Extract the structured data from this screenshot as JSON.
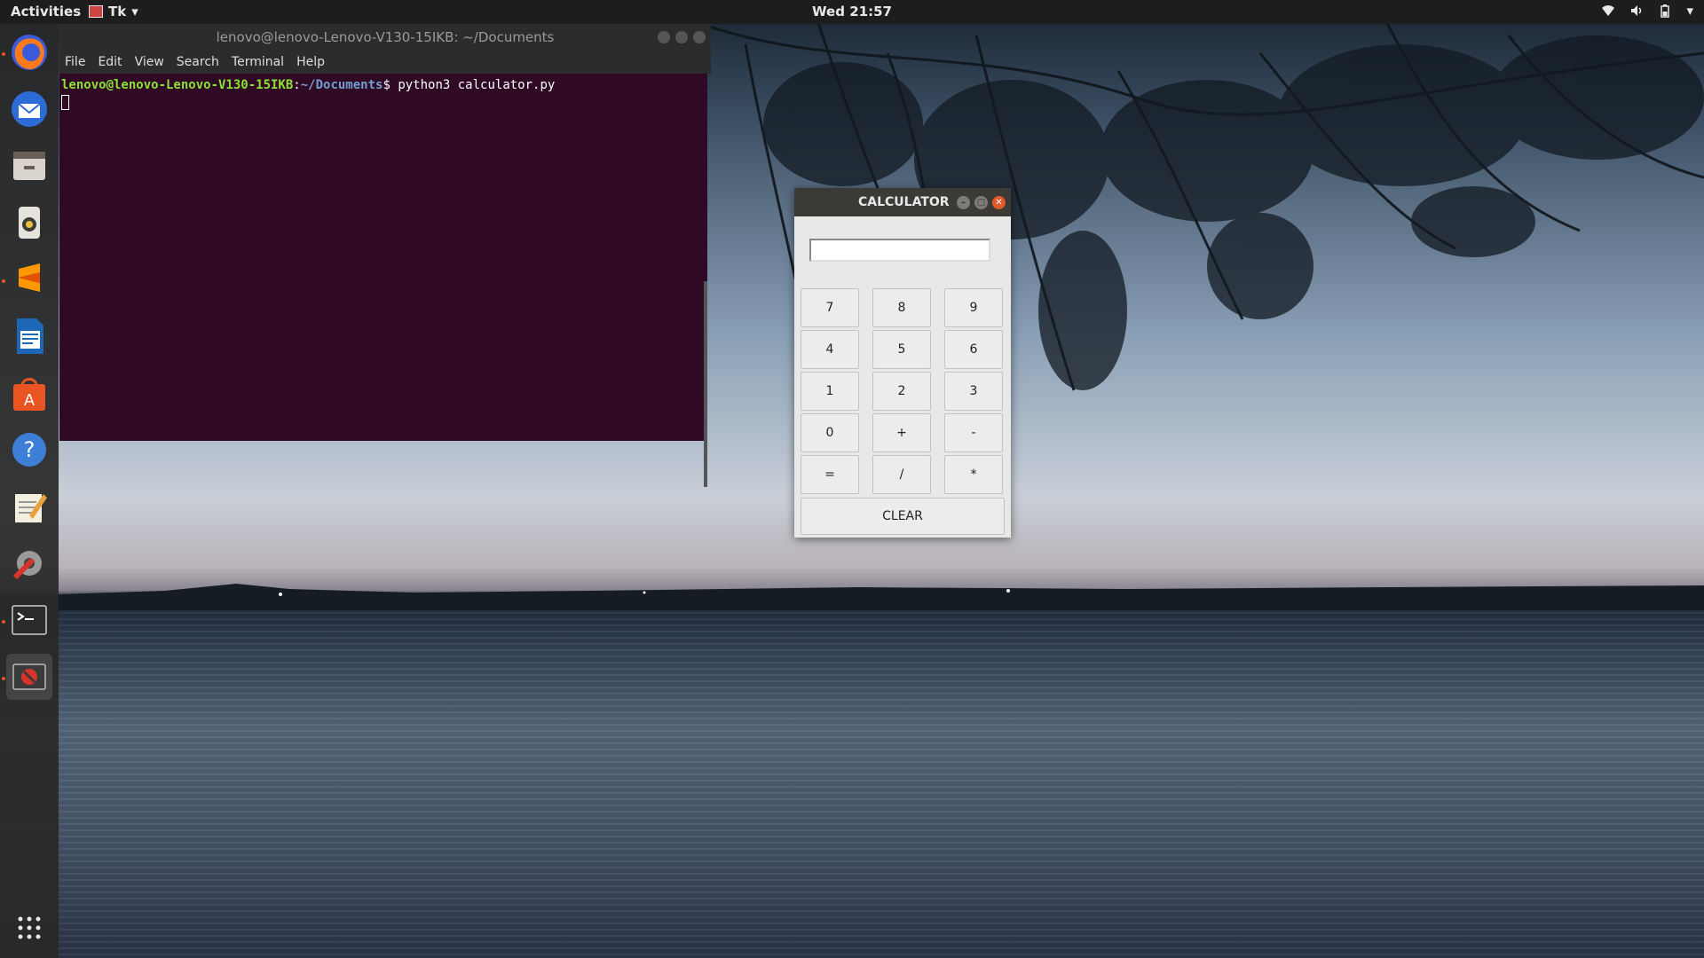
{
  "topbar": {
    "activities": "Activities",
    "app_menu": "Tk",
    "clock": "Wed 21:57",
    "tray_icons": [
      "wifi-icon",
      "volume-icon",
      "battery-icon",
      "chevron-down-icon"
    ]
  },
  "dock": {
    "items": [
      {
        "name": "firefox",
        "running": true
      },
      {
        "name": "thunderbird",
        "running": false
      },
      {
        "name": "files",
        "running": false
      },
      {
        "name": "rhythmbox",
        "running": false
      },
      {
        "name": "sublime-text",
        "running": true
      },
      {
        "name": "libreoffice-writer",
        "running": false
      },
      {
        "name": "ubuntu-software",
        "running": false
      },
      {
        "name": "help",
        "running": false
      },
      {
        "name": "text-editor",
        "running": false
      },
      {
        "name": "settings",
        "running": false
      },
      {
        "name": "terminal",
        "running": true
      },
      {
        "name": "tk-app",
        "running": true
      }
    ]
  },
  "terminal": {
    "title": "lenovo@lenovo-Lenovo-V130-15IKB: ~/Documents",
    "menu": [
      "File",
      "Edit",
      "View",
      "Search",
      "Terminal",
      "Help"
    ],
    "prompt_user": "lenovo@lenovo-Lenovo-V130-15IKB",
    "prompt_sep": ":",
    "prompt_path": "~/Documents",
    "prompt_suffix": "$ ",
    "command": "python3 calculator.py"
  },
  "calculator": {
    "title": "CALCULATOR",
    "display_value": "",
    "buttons": [
      "7",
      "8",
      "9",
      "4",
      "5",
      "6",
      "1",
      "2",
      "3",
      "0",
      "+",
      "-",
      "=",
      "/",
      "*"
    ],
    "clear_label": "CLEAR"
  },
  "colors": {
    "terminal_bg": "#300a24",
    "prompt_user": "#8ae234",
    "prompt_path": "#729fcf",
    "ubuntu_orange": "#e95420"
  }
}
